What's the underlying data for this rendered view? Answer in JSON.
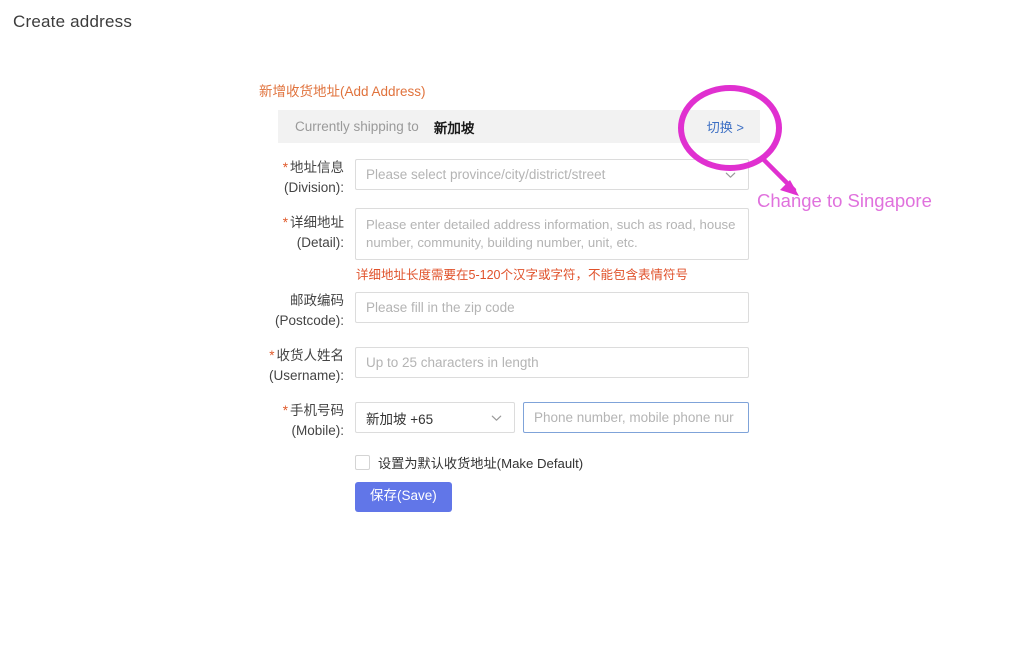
{
  "page": {
    "title": "Create address"
  },
  "panel": {
    "title": "新增收货地址(Add Address)"
  },
  "shipping_bar": {
    "label": "Currently shipping to",
    "country": "新加坡",
    "switch_link": "切换 >"
  },
  "form": {
    "fields": [
      {
        "required": true,
        "label_cn": "地址信息",
        "label_en": "(Division):",
        "type": "select",
        "placeholder": "Please select province/city/district/street",
        "value": ""
      },
      {
        "required": true,
        "label_cn": "详细地址",
        "label_en": "(Detail):",
        "type": "textarea",
        "placeholder": "Please enter detailed address information, such as road, house number, community, building number, unit, etc.",
        "value": "",
        "error": "详细地址长度需要在5-120个汉字或字符，不能包含表情符号"
      },
      {
        "required": false,
        "label_cn": "邮政编码",
        "label_en": "(Postcode):",
        "type": "text",
        "placeholder": "Please fill in the zip code",
        "value": ""
      },
      {
        "required": true,
        "label_cn": "收货人姓名",
        "label_en": "(Username):",
        "type": "text",
        "placeholder": "Up to 25 characters in length",
        "value": ""
      },
      {
        "required": true,
        "label_cn": "手机号码",
        "label_en": "(Mobile):",
        "type": "phone",
        "country_code_value": "新加坡 +65",
        "placeholder": "Phone number, mobile phone nur",
        "value": ""
      }
    ],
    "make_default_label": "设置为默认收货地址(Make Default)",
    "make_default_checked": false,
    "save_label": "保存(Save)"
  },
  "annotation": {
    "text": "Change to Singapore",
    "color": "#e071dd",
    "circle_color": "#e030d0"
  }
}
